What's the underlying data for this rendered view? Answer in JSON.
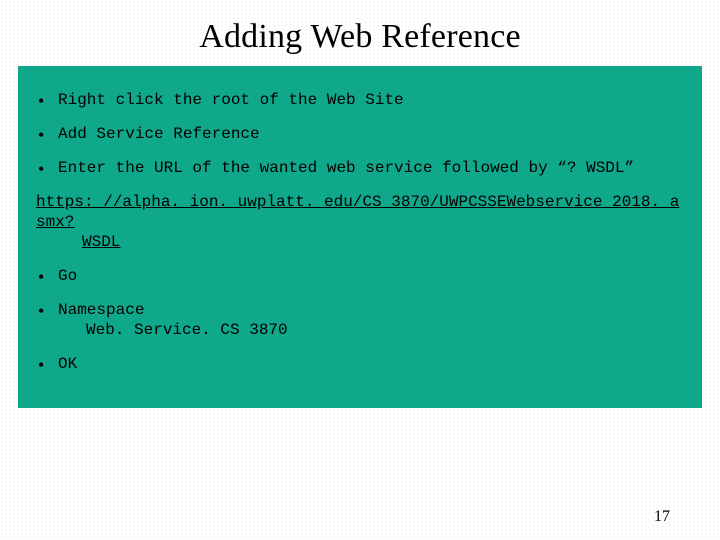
{
  "title": "Adding Web Reference",
  "bullets": {
    "b1": "Right click the root of the Web Site",
    "b2": "Add Service Reference",
    "b3": "Enter the URL of the wanted web service followed by “? WSDL”",
    "b4": "Go",
    "b5": "Namespace",
    "b5_sub": "Web. Service. CS 3870",
    "b6": "OK"
  },
  "url_line1": "https: //alpha. ion. uwplatt. edu/CS 3870/UWPCSSEWebservice 2018. asmx?",
  "url_line2": "WSDL",
  "page_number": "17"
}
